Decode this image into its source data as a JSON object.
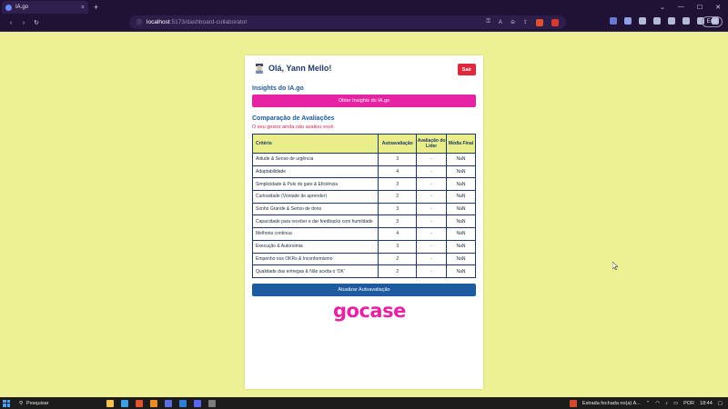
{
  "browser": {
    "tab_title": "IA.go",
    "tab_close": "×",
    "new_tab": "+",
    "url_host": "localhost",
    "url_path": ":5173/dashboard-collaborator",
    "error_pill": "Erro",
    "shield_count": "1"
  },
  "header": {
    "greeting": "Olá, Yann Mello!",
    "logout_label": "Sair"
  },
  "insights": {
    "title": "Insights do IA.go",
    "button_label": "Obter Insights do IA.go"
  },
  "comparison": {
    "title": "Comparação de Avaliações",
    "warning": "O seu gestor ainda não avaliou você.",
    "columns": [
      "Critério",
      "Autoavaliação",
      "Avaliação do Líder",
      "Média Final"
    ],
    "rows": [
      {
        "criterion": "Atitude & Senso de urgência",
        "self": "3",
        "leader": "-",
        "avg": "NaN"
      },
      {
        "criterion": "Adaptabilidade",
        "self": "4",
        "leader": "-",
        "avg": "NaN"
      },
      {
        "criterion": "Simplicidade & Pulo do gato & Eficiência",
        "self": "3",
        "leader": "-",
        "avg": "NaN"
      },
      {
        "criterion": "Curiosidade (Vontade de aprender)",
        "self": "2",
        "leader": "-",
        "avg": "NaN"
      },
      {
        "criterion": "Sonho Grande & Senso de dono",
        "self": "3",
        "leader": "-",
        "avg": "NaN"
      },
      {
        "criterion": "Capacidade para receber e dar feedbacks com humildade",
        "self": "3",
        "leader": "-",
        "avg": "NaN"
      },
      {
        "criterion": "Melhoria contínua",
        "self": "4",
        "leader": "-",
        "avg": "NaN"
      },
      {
        "criterion": "Execução & Autonomia",
        "self": "3",
        "leader": "-",
        "avg": "NaN"
      },
      {
        "criterion": "Empenho nos OKRs & Inconformismo",
        "self": "2",
        "leader": "-",
        "avg": "NaN"
      },
      {
        "criterion": "Qualidade das entregas & Não aceita o 'OK'",
        "self": "2",
        "leader": "-",
        "avg": "NaN"
      }
    ],
    "update_button": "Atualizar Autoavaliação"
  },
  "brand": {
    "logo_text": "gocase",
    "logo_color": "#e523a3"
  },
  "taskbar": {
    "search_placeholder": "Pesquisar",
    "weather_text": "Estrada fechada no(a) A...",
    "language": "POR",
    "time": "18:44"
  },
  "colors": {
    "page_bg": "#eef193",
    "primary_blue": "#1e5aa0",
    "magenta": "#e523a3",
    "red": "#e0283c"
  }
}
